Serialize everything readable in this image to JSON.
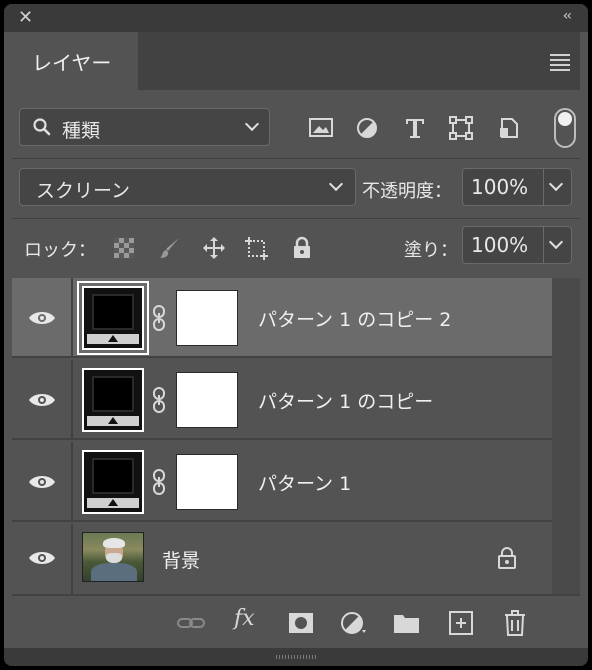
{
  "window": {
    "close_glyph": "✕",
    "collapse_glyph": "‹‹"
  },
  "tabs": [
    {
      "label": "レイヤー",
      "active": true
    }
  ],
  "filter": {
    "kind_label": "種類",
    "filter_icons": [
      "image-filter-icon",
      "adjustment-filter-icon",
      "type-filter-icon",
      "shape-filter-icon",
      "smart-object-filter-icon"
    ],
    "filter_toggle_on": true
  },
  "blending": {
    "mode": "スクリーン",
    "opacity_label": "不透明度：",
    "opacity_value": "100%"
  },
  "locks": {
    "label": "ロック：",
    "icons": [
      "lock-transparent-icon",
      "lock-pixels-icon",
      "lock-position-icon",
      "lock-artboard-icon",
      "lock-all-icon"
    ],
    "fill_label": "塗り：",
    "fill_value": "100%"
  },
  "layers": [
    {
      "name": "パターン 1 のコピー 2",
      "visible": true,
      "selected": true,
      "has_mask": true
    },
    {
      "name": "パターン 1 のコピー",
      "visible": true,
      "selected": false,
      "has_mask": true
    },
    {
      "name": "パターン 1",
      "visible": true,
      "selected": false,
      "has_mask": true
    },
    {
      "name": "背景",
      "visible": true,
      "selected": false,
      "has_mask": false,
      "locked": true
    }
  ],
  "footer": {
    "fx_label": "fx",
    "icons": [
      "link-layers-icon",
      "fx-icon",
      "add-mask-icon",
      "adjustment-layer-icon",
      "new-group-icon",
      "new-layer-icon",
      "delete-layer-icon"
    ]
  },
  "colors": {
    "panel_bg": "#535353",
    "selected_row": "#6b6b6b",
    "titlebar": "#3a3a3a"
  }
}
